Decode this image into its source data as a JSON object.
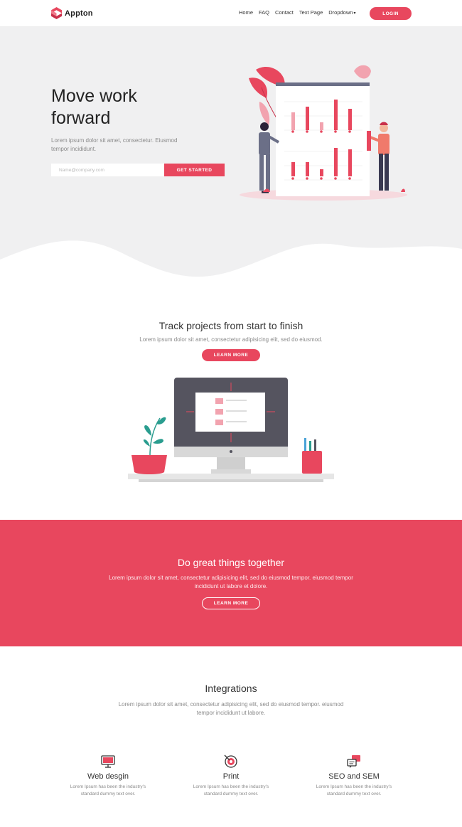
{
  "nav": {
    "brand": "Appton",
    "items": [
      "Home",
      "FAQ",
      "Contact",
      "Text Page",
      "Dropdown"
    ],
    "login": "LOGIN"
  },
  "hero": {
    "title": "Move work forward",
    "subtitle": "Lorem ipsum dolor sit amet, consectetur. Eiusmod tempor incididunt.",
    "email_placeholder": "Name@company.com",
    "cta": "GET STARTED"
  },
  "track": {
    "title": "Track projects from start to finish",
    "text": "Lorem ipsum dolor sit amet, consectetur adipisicing elit, sed do eiusmod.",
    "button": "LEARN MORE"
  },
  "together": {
    "title": "Do great things together",
    "text": "Lorem ipsum dolor sit amet, consectetur adipisicing elit, sed do eiusmod tempor. eiusmod tempor incididunt ut labore et dolore.",
    "button": "LEARN MORE"
  },
  "integrations": {
    "title": "Integrations",
    "text": "Lorem ipsum dolor sit amet, consectetur adipisicing elit, sed do eiusmod tempor. eiusmod tempor incididunt ut labore.",
    "features": [
      {
        "name": "Web desgin",
        "icon": "monitor-icon",
        "desc": "Lorem Ipsum has been the industry's standard dummy text over."
      },
      {
        "name": "Print",
        "icon": "target-icon",
        "desc": "Lorem Ipsum has been the industry's standard dummy text over."
      },
      {
        "name": "SEO and SEM",
        "icon": "chat-bubbles-icon",
        "desc": "Lorem Ipsum has been the industry's standard dummy text over."
      }
    ]
  },
  "colors": {
    "accent": "#e8475e",
    "hero_bg": "#f0f0f1",
    "dark_text": "#222222",
    "muted_text": "#8a8a8a"
  }
}
